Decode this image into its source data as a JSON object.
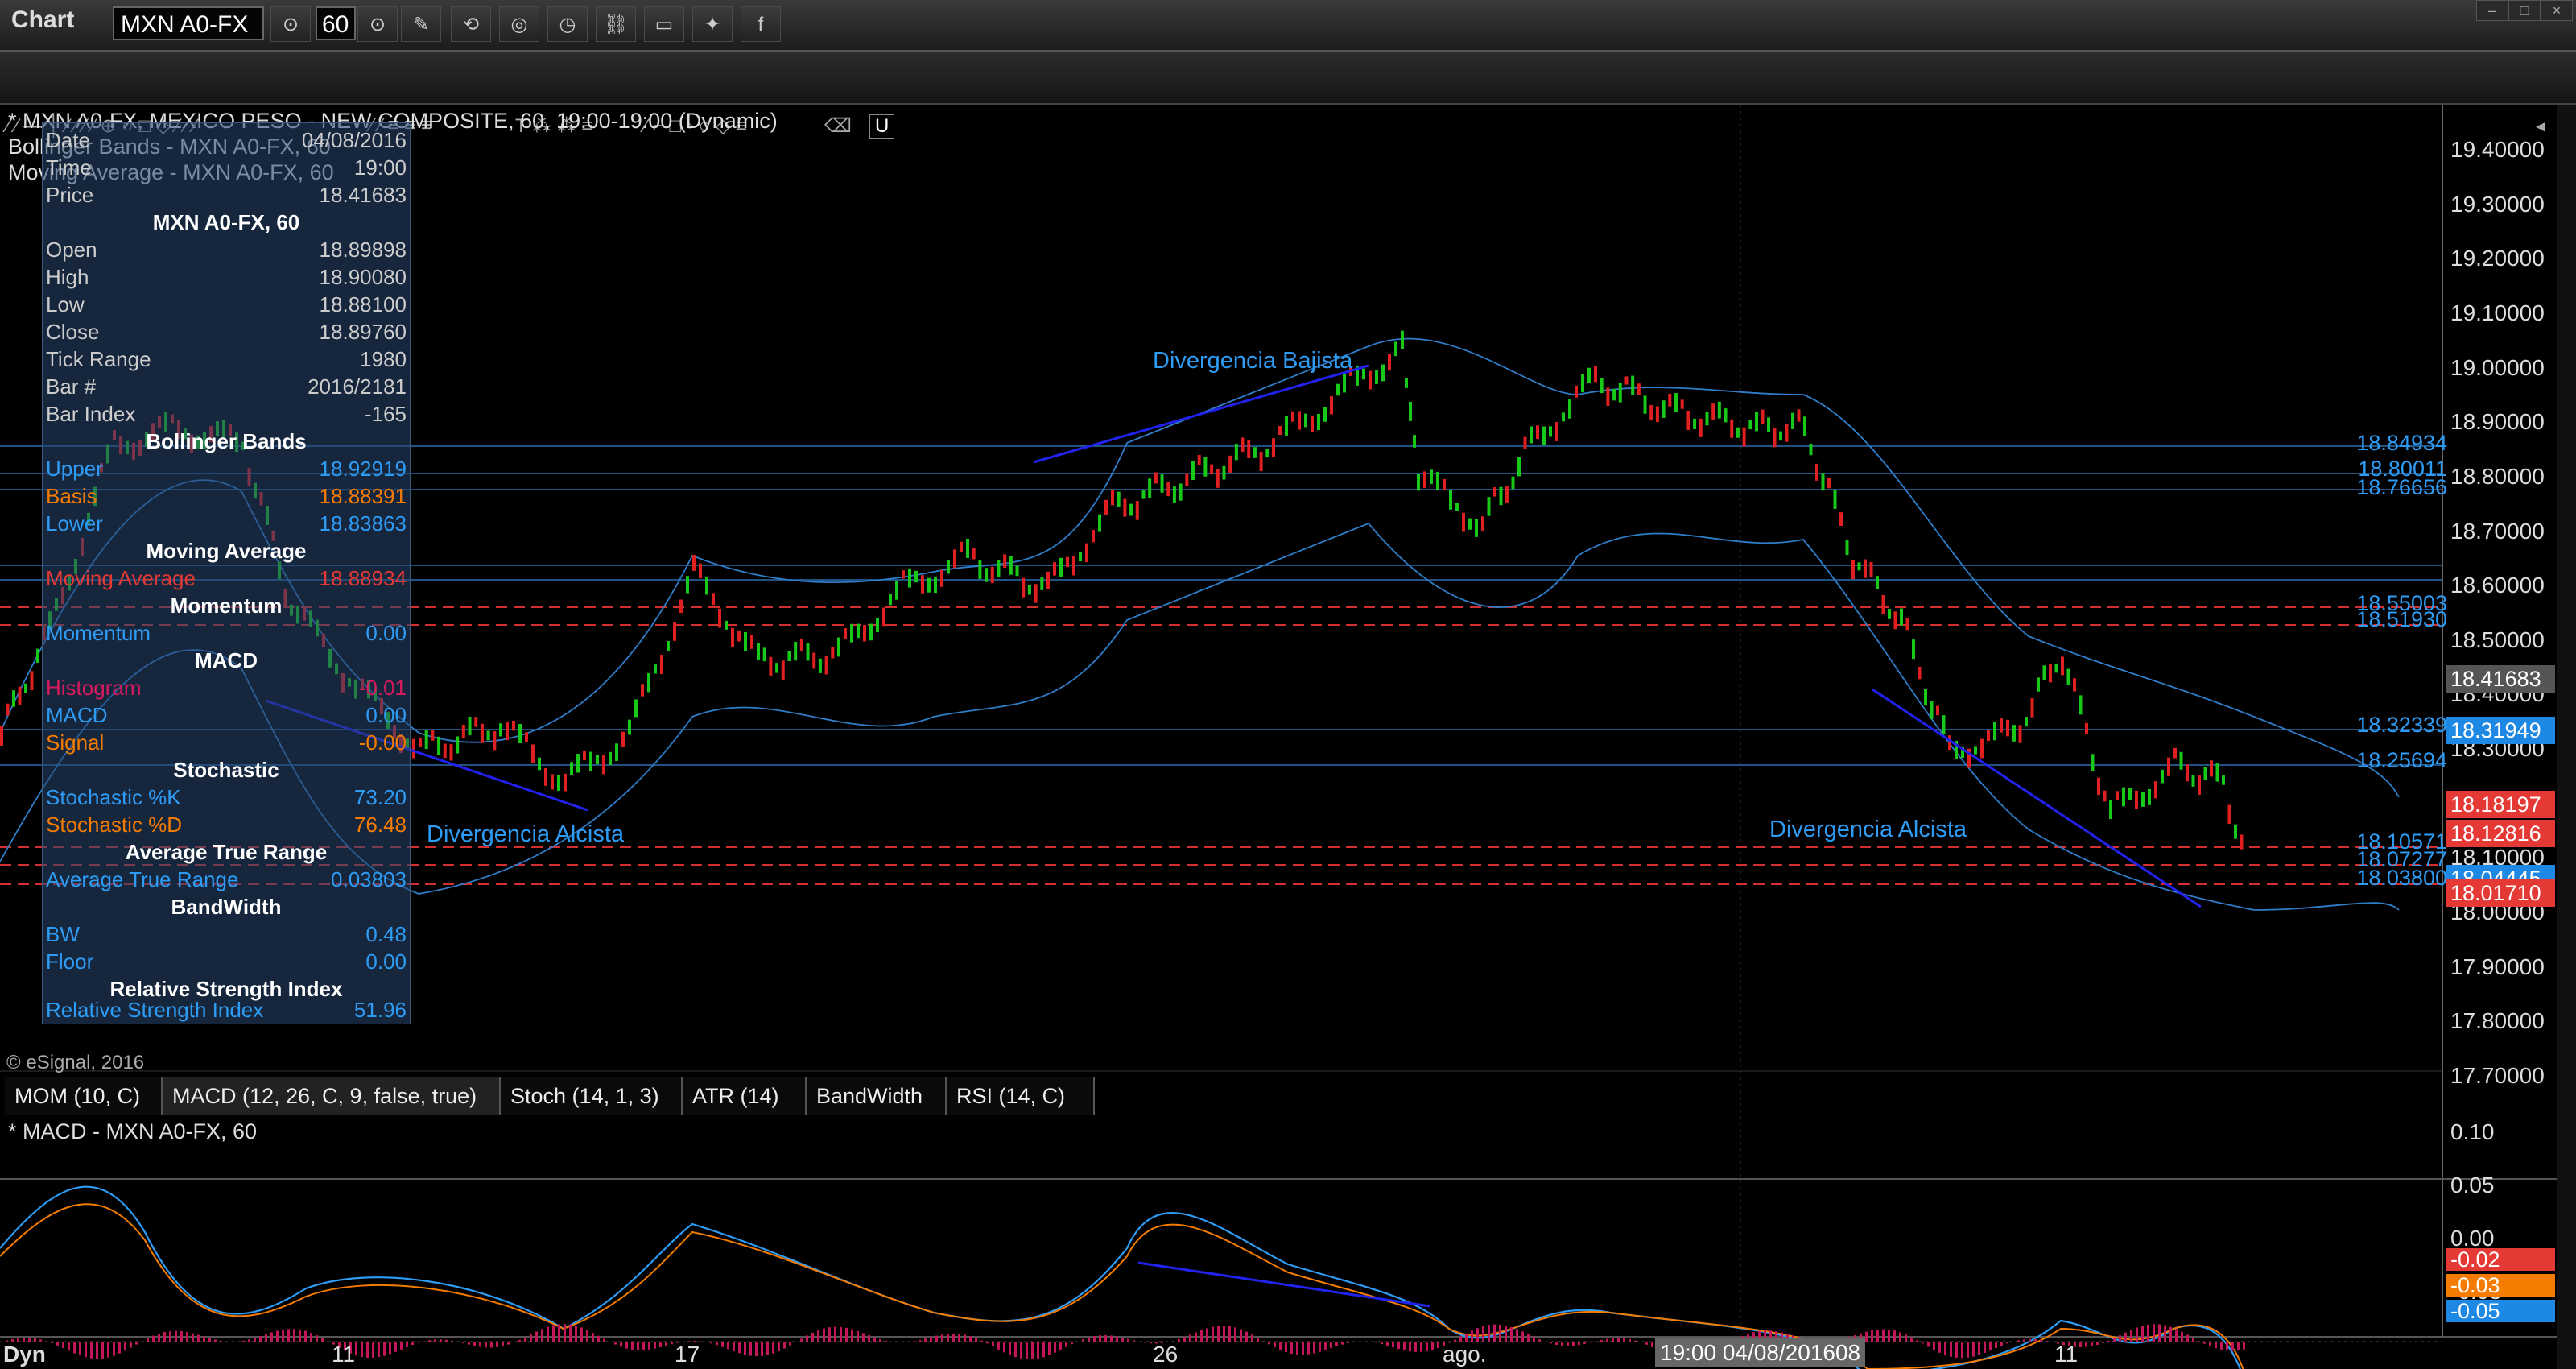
{
  "app": {
    "title": "Chart",
    "symbol": "MXN A0-FX",
    "interval": "60"
  },
  "panel_title": "* MXN A0-FX, MEXICO PESO - NEW COMPOSITE, 60, 19:00-19:00 (Dynamic)",
  "overlay_lines": [
    "Bollinger Bands - MXN A0-FX, 60",
    "Moving Average - MXN A0-FX, 60"
  ],
  "copyright": "© eSignal, 2016",
  "data_window": {
    "date_label": "Date",
    "date": "04/08/2016",
    "time_label": "Time",
    "time": "19:00",
    "price_label": "Price",
    "price": "18.41683",
    "header_main": "MXN A0-FX, 60",
    "open_label": "Open",
    "open": "18.89898",
    "high_label": "High",
    "high": "18.90080",
    "low_label": "Low",
    "low": "18.88100",
    "close_label": "Close",
    "close": "18.89760",
    "tick_label": "Tick Range",
    "tick": "1980",
    "bar_label": "Bar #",
    "bar": "2016/2181",
    "barindex_label": "Bar Index",
    "barindex": "-165",
    "bb_header": "Bollinger Bands",
    "upper_label": "Upper",
    "upper": "18.92919",
    "basis_label": "Basis",
    "basis": "18.88391",
    "lower_label": "Lower",
    "lower": "18.83863",
    "ma_header": "Moving Average",
    "ma_label": "Moving Average",
    "ma": "18.88934",
    "mom_header": "Momentum",
    "mom_label": "Momentum",
    "mom": "0.00",
    "macd_header": "MACD",
    "hist_label": "Histogram",
    "hist": "-0.01",
    "macd_label": "MACD",
    "macd": "0.00",
    "signal_label": "Signal",
    "signal": "-0.00",
    "stoch_header": "Stochastic",
    "k_label": "Stochastic %K",
    "k": "73.20",
    "d_label": "Stochastic %D",
    "d": "76.48",
    "atr_header": "Average True Range",
    "atr_label": "Average True Range",
    "atr": "0.03803",
    "bw_header": "BandWidth",
    "bw_label": "BW",
    "bw": "0.48",
    "floor_label": "Floor",
    "floor": "0.00",
    "rsi_header": "Relative Strength Index",
    "rsi_label": "Relative Strength Index",
    "rsi": "51.96"
  },
  "price_axis": [
    "19.40000",
    "19.30000",
    "19.20000",
    "19.10000",
    "19.00000",
    "18.90000",
    "18.80000",
    "18.70000",
    "18.60000",
    "18.50000",
    "18.40000",
    "18.30000",
    "18.20000",
    "18.10000",
    "18.00000",
    "17.90000",
    "17.80000",
    "17.70000"
  ],
  "level_labels": [
    "18.84934",
    "18.80011",
    "18.76656",
    "18.55003",
    "18.51930",
    "18.32339",
    "18.25694",
    "18.10571",
    "18.07277",
    "18.03800"
  ],
  "price_tags": [
    {
      "value": "18.41683",
      "color": "#555555"
    },
    {
      "value": "18.31949",
      "color": "#1e88e5"
    },
    {
      "value": "18.18197",
      "color": "#e53935"
    },
    {
      "value": "18.12816",
      "color": "#e53935"
    },
    {
      "value": "18.04445",
      "color": "#1e88e5"
    },
    {
      "value": "18.01710",
      "color": "#e53935"
    }
  ],
  "annotations": {
    "bearish_div": "Divergencia Bajista",
    "bullish_div_1": "Divergencia Alcista",
    "bullish_div_2": "Divergencia Alcista"
  },
  "tabs": [
    "MOM (10, C)",
    "MACD (12, 26, C, 9, false, true)",
    "Stoch (14, 1, 3)",
    "ATR (14)",
    "BandWidth",
    "RSI (14, C)"
  ],
  "macd_panel_title": "* MACD - MXN A0-FX, 60",
  "macd_axis": [
    "0.10",
    "0.05",
    "0.00",
    "-0.05"
  ],
  "macd_tags": [
    {
      "value": "-0.02",
      "color": "#e53935"
    },
    {
      "value": "-0.03",
      "color": "#f57c00"
    },
    {
      "value": "-0.05",
      "color": "#1e88e5"
    }
  ],
  "x_axis": [
    "11",
    "17",
    "26",
    "ago.",
    "11"
  ],
  "crosshair_time": "19:00 04/08/2016",
  "crosshair_suffix": "08",
  "dyn_label": "Dyn"
}
